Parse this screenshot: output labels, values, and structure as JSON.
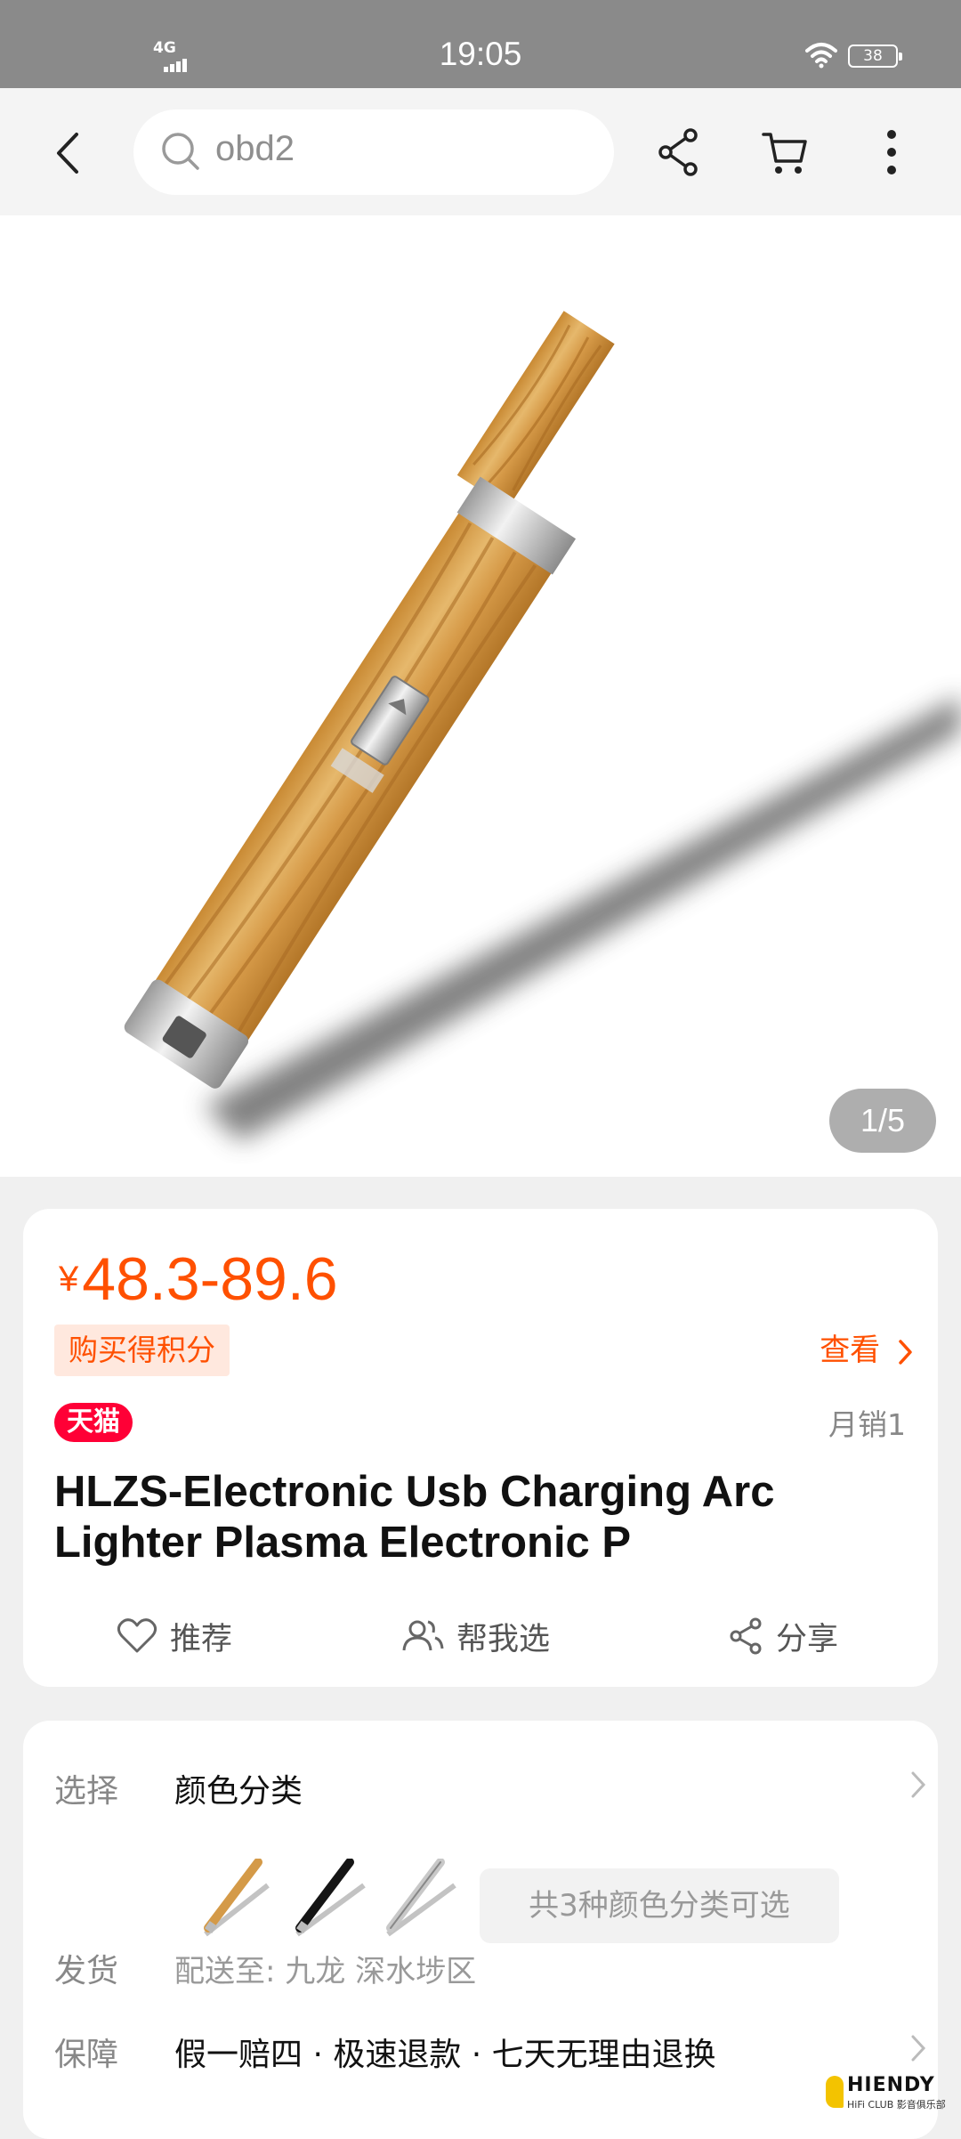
{
  "status_bar": {
    "network": "4G",
    "time": "19:05",
    "battery": "38"
  },
  "nav": {
    "back_icon": "chevron-left-icon",
    "search_placeholder": "obd2",
    "share_icon": "share-icon",
    "cart_icon": "cart-icon",
    "more_icon": "more-vertical-icon"
  },
  "gallery": {
    "page_indicator": "1/5"
  },
  "price_card": {
    "currency": "¥",
    "price_range": "48.3-89.6",
    "points_tag": "购买得积分",
    "view_link": "查看",
    "store_badge": "天猫",
    "monthly_sales": "月销1",
    "title": "HLZS-Electronic Usb Charging Arc Lighter Plasma Electronic P",
    "actions": [
      {
        "icon": "heart-icon",
        "label": "推荐"
      },
      {
        "icon": "people-icon",
        "label": "帮我选"
      },
      {
        "icon": "share-icon",
        "label": "分享"
      }
    ]
  },
  "spec_card": {
    "select_key": "选择",
    "select_value": "颜色分类",
    "color_count": "共3种颜色分类可选",
    "swatches": [
      "wood",
      "black",
      "silver"
    ],
    "ship_key": "发货",
    "ship_value": "配送至: 九龙 深水埗区",
    "guarantee_key": "保障",
    "guarantee_value": "假一赔四 · 极速退款 · 七天无理由退换"
  },
  "watermark": {
    "brand": "HIENDY",
    "sub": "HiFi CLUB 影音俱乐部"
  },
  "colors": {
    "accent": "#ff5000",
    "tmall": "#ff0036",
    "status_bar": "#8a8a8a"
  }
}
